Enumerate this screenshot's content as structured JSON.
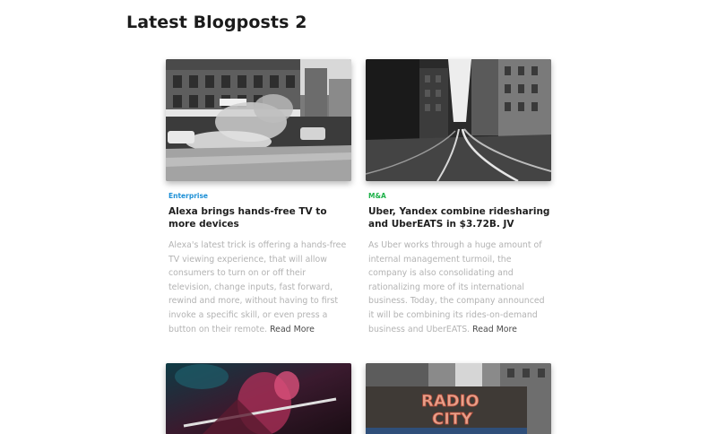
{
  "page": {
    "title": "Latest Blogposts 2"
  },
  "posts": [
    {
      "category": "Enterprise",
      "category_color": "#1b8fd6",
      "title": "Alexa brings hands-free TV to more devices",
      "excerpt": "Alexa's latest trick is offering a hands-free TV viewing experience, that will allow consumers to turn on or off their television, change inputs, fast forward, rewind and more, without having to first invoke a specific skill, or even press a button on their remote.",
      "read_more": "Read More",
      "image": "city-street-steam-photo"
    },
    {
      "category": "M&A",
      "category_color": "#1fb24a",
      "title": "Uber, Yandex combine ridesharing and UberEATS in $3.72B. JV",
      "excerpt": "As Uber works through a huge amount of internal management turmoil, the company is also consolidating and rationalizing more of its international business. Today, the company announced it will be combining its rides-on-demand business and UberEATS.",
      "read_more": "Read More",
      "image": "city-tram-tracks-photo"
    },
    {
      "image": "concert-guitarist-photo"
    },
    {
      "image": "radio-city-sign-photo",
      "image_text": [
        "RADIO",
        "CITY"
      ]
    }
  ]
}
